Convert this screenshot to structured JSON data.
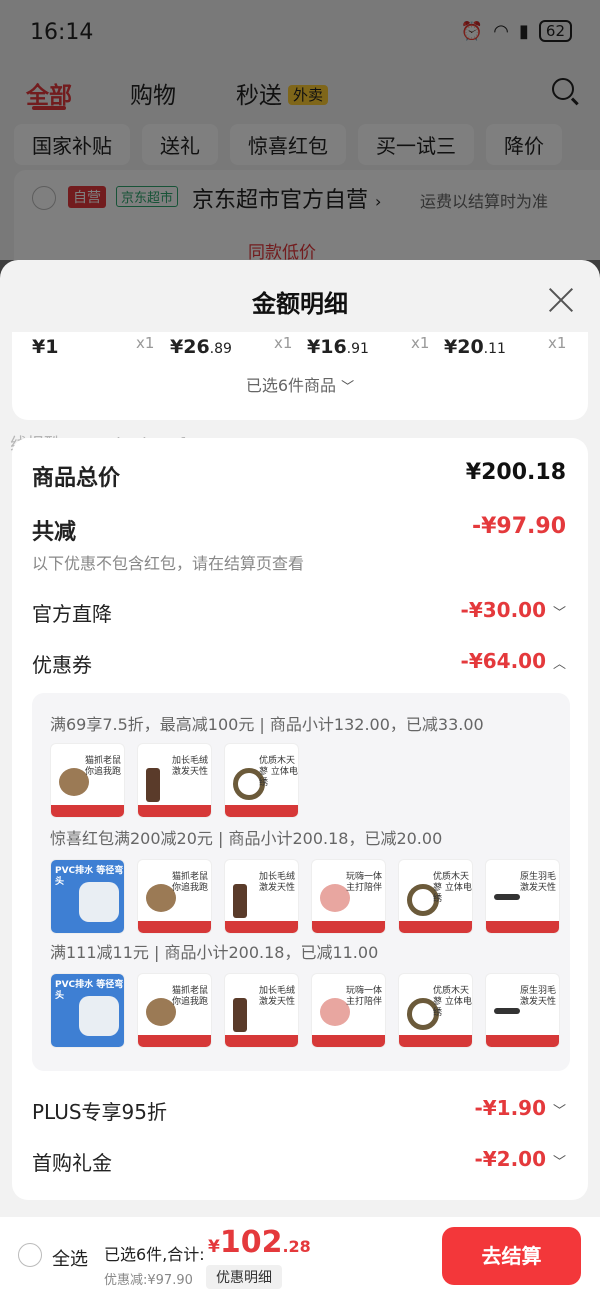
{
  "status_bar": {
    "time": "16:14",
    "battery": "62"
  },
  "top_tabs": {
    "all": "全部",
    "shopping": "购物",
    "instant": "秒送",
    "takeout_badge": "外卖"
  },
  "filter_chips": [
    "国家补贴",
    "送礼",
    "惊喜红包",
    "买一试三",
    "降价"
  ],
  "store": {
    "self_badge": "自营",
    "market_badge": "京东超市",
    "name": "京东超市官方自营",
    "arrow": "›",
    "shipping_note": "运费以结算时为准",
    "low_price": "同款低价"
  },
  "sheet": {
    "title": "金额明细",
    "products": [
      {
        "price_int": "¥1",
        "price_dec": "",
        "qty": "x1"
      },
      {
        "price_int": "¥26",
        "price_dec": ".89",
        "qty": "x1"
      },
      {
        "price_int": "¥16",
        "price_dec": ".91",
        "qty": "x1"
      },
      {
        "price_int": "¥20",
        "price_dec": ".11",
        "qty": "x1"
      }
    ],
    "selected_count": "已选6件商品",
    "watermark": "线报酷-new.xianbao.fun",
    "total_label": "商品总价",
    "total_value": "¥200.18",
    "reduce_label": "共减",
    "reduce_value": "-¥97.90",
    "reduce_note": "以下优惠不包含红包，请在结算页查看",
    "official_label": "官方直降",
    "official_value": "-¥30.00",
    "coupon_label": "优惠券",
    "coupon_value": "-¥64.00",
    "coupons": [
      {
        "text": "满69享7.5折，最高减100元 | 商品小计132.00，已减33.00"
      },
      {
        "text": "惊喜红包满200减20元 | 商品小计200.18，已减20.00"
      },
      {
        "text": "满111减11元 | 商品小计200.18，已减11.00"
      }
    ],
    "thumb_texts": {
      "mouse": "猫抓老鼠 你追我跑",
      "feather": "加长毛绒 激发天性",
      "ring": "优质木天蓼 立体电绣",
      "bear": "玩嗨一体 主打陪伴",
      "feather2": "原生羽毛 激发天性",
      "pvc": "PVC排水 等径弯头"
    },
    "plus_label": "PLUS专享95折",
    "plus_value": "-¥1.90",
    "first_label": "首购礼金",
    "first_value": "-¥2.00"
  },
  "bottom_bar": {
    "select_all": "全选",
    "summary": "已选6件,合计:",
    "currency": "¥",
    "total_int": "102",
    "total_dec": ".28",
    "discount_note": "优惠减:¥97.90",
    "detail_button": "优惠明细",
    "checkout": "去结算"
  },
  "colors": {
    "accent": "#e4393c",
    "checkout": "#f3373a"
  }
}
